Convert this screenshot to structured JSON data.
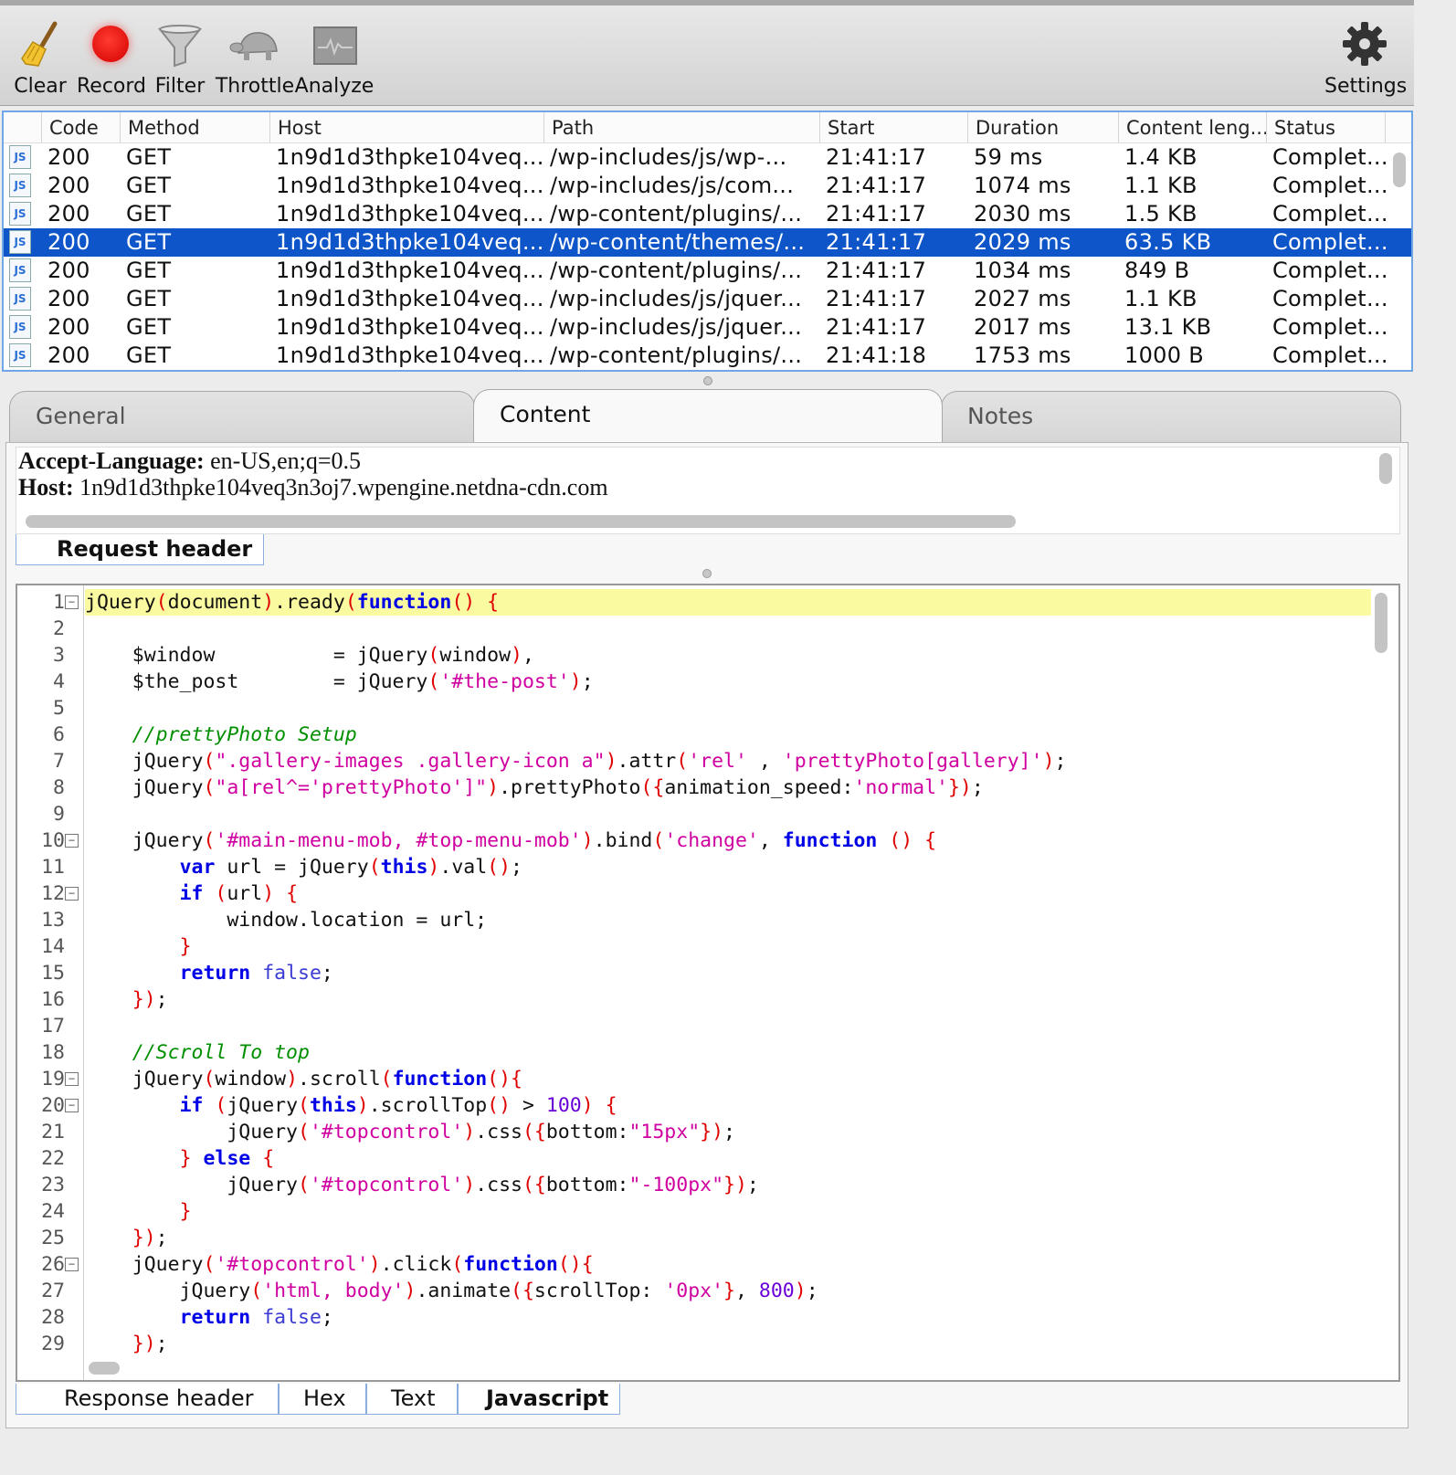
{
  "toolbar": {
    "clear_label": "Clear",
    "record_label": "Record",
    "filter_label": "Filter",
    "throttle_label": "Throttle",
    "analyze_label": "Analyze",
    "settings_label": "Settings"
  },
  "table": {
    "columns": [
      "Code",
      "Method",
      "Host",
      "Path",
      "Start",
      "Duration",
      "Content leng...",
      "Status"
    ],
    "rows": [
      {
        "code": "200",
        "method": "GET",
        "host": "1n9d1d3thpke104veq...",
        "path": "/wp-includes/js/wp-...",
        "start": "21:41:17",
        "duration": "59 ms",
        "length": "1.4 KB",
        "status": "Complet..."
      },
      {
        "code": "200",
        "method": "GET",
        "host": "1n9d1d3thpke104veq...",
        "path": "/wp-includes/js/com...",
        "start": "21:41:17",
        "duration": "1074 ms",
        "length": "1.1 KB",
        "status": "Complet..."
      },
      {
        "code": "200",
        "method": "GET",
        "host": "1n9d1d3thpke104veq...",
        "path": "/wp-content/plugins/...",
        "start": "21:41:17",
        "duration": "2030 ms",
        "length": "1.5 KB",
        "status": "Complet..."
      },
      {
        "code": "200",
        "method": "GET",
        "host": "1n9d1d3thpke104veq...",
        "path": "/wp-content/themes/...",
        "start": "21:41:17",
        "duration": "2029 ms",
        "length": "63.5 KB",
        "status": "Complet..."
      },
      {
        "code": "200",
        "method": "GET",
        "host": "1n9d1d3thpke104veq...",
        "path": "/wp-content/plugins/...",
        "start": "21:41:17",
        "duration": "1034 ms",
        "length": "849 B",
        "status": "Complet..."
      },
      {
        "code": "200",
        "method": "GET",
        "host": "1n9d1d3thpke104veq...",
        "path": "/wp-includes/js/jquer...",
        "start": "21:41:17",
        "duration": "2027 ms",
        "length": "1.1 KB",
        "status": "Complet..."
      },
      {
        "code": "200",
        "method": "GET",
        "host": "1n9d1d3thpke104veq...",
        "path": "/wp-includes/js/jquer...",
        "start": "21:41:17",
        "duration": "2017 ms",
        "length": "13.1 KB",
        "status": "Complet..."
      },
      {
        "code": "200",
        "method": "GET",
        "host": "1n9d1d3thpke104veq...",
        "path": "/wp-content/plugins/...",
        "start": "21:41:18",
        "duration": "1753 ms",
        "length": "1000 B",
        "status": "Complet..."
      }
    ],
    "selected_index": 3,
    "icon_text": "JS"
  },
  "tabs": [
    "General",
    "Content",
    "Notes"
  ],
  "request_header": {
    "lines": [
      {
        "key": "Accept-Language:",
        "value": " en-US,en;q=0.5"
      },
      {
        "key": "Host:",
        "value": " 1n9d1d3thpke104veq3n3oj7.wpengine.netdna-cdn.com"
      }
    ],
    "tab_label": "Request header"
  },
  "bottom_tabs": [
    "Response header",
    "Hex",
    "Text",
    "Javascript"
  ],
  "colors": {
    "selection": "#0d55c8",
    "keyword": "#0000e6",
    "string": "#d000a0",
    "comment": "#008f00",
    "paren": "#e00000",
    "current_line": "#fafaa0"
  },
  "code": {
    "line_numbers": [
      "1",
      "2",
      "3",
      "4",
      "5",
      "6",
      "7",
      "8",
      "9",
      "10",
      "11",
      "12",
      "13",
      "14",
      "15",
      "16",
      "17",
      "18",
      "19",
      "20",
      "21",
      "22",
      "23",
      "24",
      "25",
      "26",
      "27",
      "28",
      "29"
    ],
    "fold_lines": [
      1,
      10,
      12,
      19,
      20,
      26
    ],
    "lines": [
      [
        [
          "",
          "jQuery"
        ],
        [
          "pn",
          "("
        ],
        [
          "",
          "document"
        ],
        [
          "pn",
          ")"
        ],
        [
          "",
          ".ready"
        ],
        [
          "pn",
          "("
        ],
        [
          "kw",
          "function"
        ],
        [
          "pn",
          "()"
        ],
        [
          "",
          " "
        ],
        [
          "pn",
          "{"
        ]
      ],
      [],
      [
        [
          "",
          "    $window          = jQuery"
        ],
        [
          "pn",
          "("
        ],
        [
          "",
          "window"
        ],
        [
          "pn",
          ")"
        ],
        [
          "",
          ","
        ]
      ],
      [
        [
          "",
          "    $the_post        = jQuery"
        ],
        [
          "pn",
          "("
        ],
        [
          "st",
          "'#the-post'"
        ],
        [
          "pn",
          ")"
        ],
        [
          "",
          ";"
        ]
      ],
      [],
      [
        [
          "cm",
          "    //prettyPhoto Setup"
        ]
      ],
      [
        [
          "",
          "    jQuery"
        ],
        [
          "pn",
          "("
        ],
        [
          "st",
          "\".gallery-images .gallery-icon a\""
        ],
        [
          "pn",
          ")"
        ],
        [
          "",
          ".attr"
        ],
        [
          "pn",
          "("
        ],
        [
          "st",
          "'rel'"
        ],
        [
          "",
          " , "
        ],
        [
          "st",
          "'prettyPhoto[gallery]'"
        ],
        [
          "pn",
          ")"
        ],
        [
          "",
          ";"
        ]
      ],
      [
        [
          "",
          "    jQuery"
        ],
        [
          "pn",
          "("
        ],
        [
          "st",
          "\"a[rel^='prettyPhoto']\""
        ],
        [
          "pn",
          ")"
        ],
        [
          "",
          ".prettyPhoto"
        ],
        [
          "pn",
          "({"
        ],
        [
          "",
          "animation_speed:"
        ],
        [
          "st",
          "'normal'"
        ],
        [
          "pn",
          "})"
        ],
        [
          "",
          ";"
        ]
      ],
      [],
      [
        [
          "",
          "    jQuery"
        ],
        [
          "pn",
          "("
        ],
        [
          "st",
          "'#main-menu-mob, #top-menu-mob'"
        ],
        [
          "pn",
          ")"
        ],
        [
          "",
          ".bind"
        ],
        [
          "pn",
          "("
        ],
        [
          "st",
          "'change'"
        ],
        [
          "",
          ", "
        ],
        [
          "kw",
          "function"
        ],
        [
          "",
          " "
        ],
        [
          "pn",
          "()"
        ],
        [
          "",
          " "
        ],
        [
          "pn",
          "{"
        ]
      ],
      [
        [
          "",
          "        "
        ],
        [
          "kw",
          "var"
        ],
        [
          "",
          " url = jQuery"
        ],
        [
          "pn",
          "("
        ],
        [
          "kw",
          "this"
        ],
        [
          "pn",
          ")"
        ],
        [
          "",
          ".val"
        ],
        [
          "pn",
          "()"
        ],
        [
          "",
          ";"
        ]
      ],
      [
        [
          "",
          "        "
        ],
        [
          "kw",
          "if"
        ],
        [
          "",
          " "
        ],
        [
          "pn",
          "("
        ],
        [
          "",
          "url"
        ],
        [
          "pn",
          ")"
        ],
        [
          "",
          " "
        ],
        [
          "pn",
          "{"
        ]
      ],
      [
        [
          "",
          "            window.location = url;"
        ]
      ],
      [
        [
          "",
          "        "
        ],
        [
          "pn",
          "}"
        ]
      ],
      [
        [
          "",
          "        "
        ],
        [
          "kw",
          "return"
        ],
        [
          "",
          " "
        ],
        [
          "fs",
          "false"
        ],
        [
          "",
          ";"
        ]
      ],
      [
        [
          "",
          "    "
        ],
        [
          "pn",
          "})"
        ],
        [
          "",
          ";"
        ]
      ],
      [],
      [
        [
          "cm",
          "    //Scroll To top"
        ]
      ],
      [
        [
          "",
          "    jQuery"
        ],
        [
          "pn",
          "("
        ],
        [
          "",
          "window"
        ],
        [
          "pn",
          ")"
        ],
        [
          "",
          ".scroll"
        ],
        [
          "pn",
          "("
        ],
        [
          "kw",
          "function"
        ],
        [
          "pn",
          "(){"
        ]
      ],
      [
        [
          "",
          "        "
        ],
        [
          "kw",
          "if"
        ],
        [
          "",
          " "
        ],
        [
          "pn",
          "("
        ],
        [
          "",
          "jQuery"
        ],
        [
          "pn",
          "("
        ],
        [
          "kw",
          "this"
        ],
        [
          "pn",
          ")"
        ],
        [
          "",
          ".scrollTop"
        ],
        [
          "pn",
          "()"
        ],
        [
          "",
          " > "
        ],
        [
          "nm",
          "100"
        ],
        [
          "pn",
          ")"
        ],
        [
          "",
          " "
        ],
        [
          "pn",
          "{"
        ]
      ],
      [
        [
          "",
          "            jQuery"
        ],
        [
          "pn",
          "("
        ],
        [
          "st",
          "'#topcontrol'"
        ],
        [
          "pn",
          ")"
        ],
        [
          "",
          ".css"
        ],
        [
          "pn",
          "({"
        ],
        [
          "",
          "bottom:"
        ],
        [
          "st",
          "\"15px\""
        ],
        [
          "pn",
          "})"
        ],
        [
          "",
          ";"
        ]
      ],
      [
        [
          "",
          "        "
        ],
        [
          "pn",
          "}"
        ],
        [
          "",
          " "
        ],
        [
          "kw",
          "else"
        ],
        [
          "",
          " "
        ],
        [
          "pn",
          "{"
        ]
      ],
      [
        [
          "",
          "            jQuery"
        ],
        [
          "pn",
          "("
        ],
        [
          "st",
          "'#topcontrol'"
        ],
        [
          "pn",
          ")"
        ],
        [
          "",
          ".css"
        ],
        [
          "pn",
          "({"
        ],
        [
          "",
          "bottom:"
        ],
        [
          "st",
          "\"-100px\""
        ],
        [
          "pn",
          "})"
        ],
        [
          "",
          ";"
        ]
      ],
      [
        [
          "",
          "        "
        ],
        [
          "pn",
          "}"
        ]
      ],
      [
        [
          "",
          "    "
        ],
        [
          "pn",
          "})"
        ],
        [
          "",
          ";"
        ]
      ],
      [
        [
          "",
          "    jQuery"
        ],
        [
          "pn",
          "("
        ],
        [
          "st",
          "'#topcontrol'"
        ],
        [
          "pn",
          ")"
        ],
        [
          "",
          ".click"
        ],
        [
          "pn",
          "("
        ],
        [
          "kw",
          "function"
        ],
        [
          "pn",
          "(){"
        ]
      ],
      [
        [
          "",
          "        jQuery"
        ],
        [
          "pn",
          "("
        ],
        [
          "st",
          "'html, body'"
        ],
        [
          "pn",
          ")"
        ],
        [
          "",
          ".animate"
        ],
        [
          "pn",
          "({"
        ],
        [
          "",
          "scrollTop: "
        ],
        [
          "st",
          "'0px'"
        ],
        [
          "pn",
          "}"
        ],
        [
          "",
          ", "
        ],
        [
          "nm",
          "800"
        ],
        [
          "pn",
          ")"
        ],
        [
          "",
          ";"
        ]
      ],
      [
        [
          "",
          "        "
        ],
        [
          "kw",
          "return"
        ],
        [
          "",
          " "
        ],
        [
          "fs",
          "false"
        ],
        [
          "",
          ";"
        ]
      ],
      [
        [
          "",
          "    "
        ],
        [
          "pn",
          "})"
        ],
        [
          "",
          ";"
        ]
      ]
    ]
  }
}
